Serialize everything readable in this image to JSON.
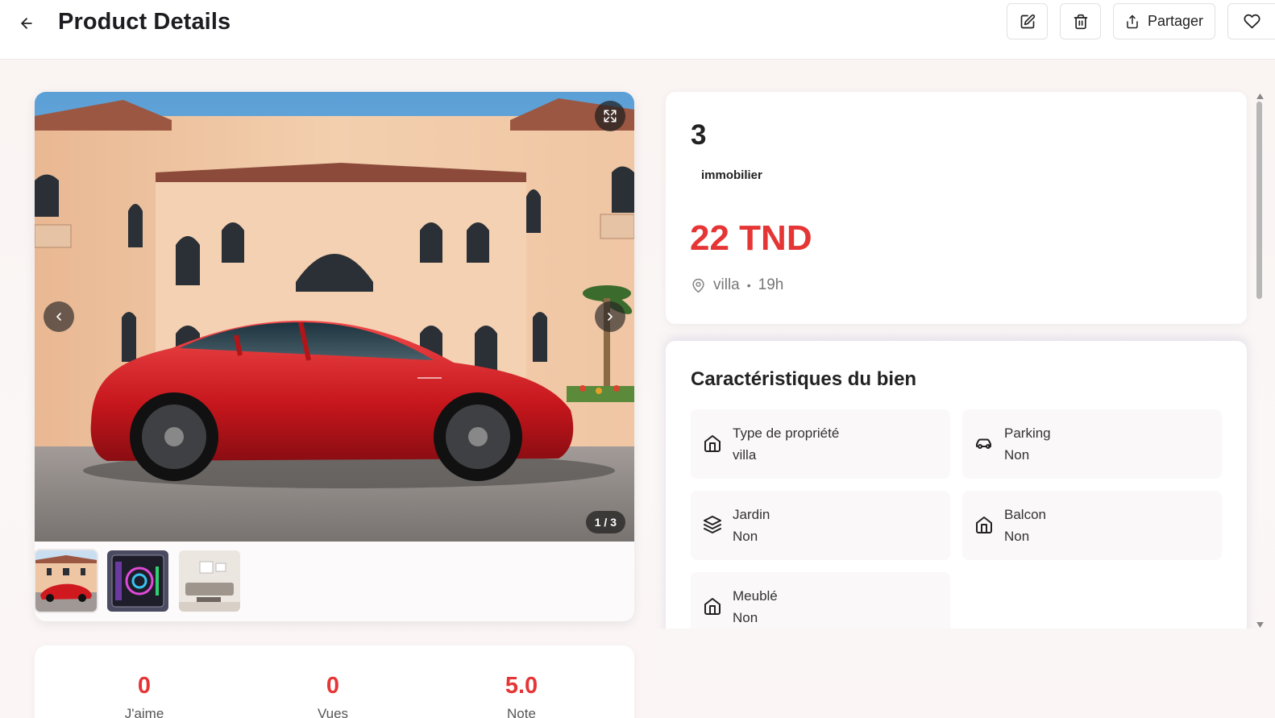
{
  "header": {
    "title": "Product Details",
    "share_label": "Partager",
    "icons": {
      "back": "arrow-left-icon",
      "edit": "pencil-square-icon",
      "delete": "trash-icon",
      "share": "upload-icon",
      "favorite": "heart-icon"
    }
  },
  "gallery": {
    "counter": "1 / 3",
    "thumbnails": [
      "red-car-villa-thumb",
      "pc-case-rgb-thumb",
      "living-room-thumb"
    ],
    "icons": {
      "fullscreen": "expand-icon",
      "prev": "chevron-left-icon",
      "next": "chevron-right-icon"
    }
  },
  "stats": [
    {
      "value": "0",
      "label": "J'aime"
    },
    {
      "value": "0",
      "label": "Vues"
    },
    {
      "value": "5.0",
      "label": "Note"
    }
  ],
  "product": {
    "name": "3",
    "category": "immobilier",
    "price": "22 TND",
    "location": "villa",
    "separator": "•",
    "age": "19h",
    "location_icon": "map-pin-icon"
  },
  "features": {
    "title": "Caractéristiques du bien",
    "items": [
      {
        "label": "Type de propriété",
        "value": "villa",
        "icon": "home-icon"
      },
      {
        "label": "Parking",
        "value": "Non",
        "icon": "car-icon"
      },
      {
        "label": "Jardin",
        "value": "Non",
        "icon": "layers-icon"
      },
      {
        "label": "Balcon",
        "value": "Non",
        "icon": "home-icon"
      },
      {
        "label": "Meublé",
        "value": "Non",
        "icon": "home-icon"
      }
    ]
  },
  "colors": {
    "accent": "#e53535",
    "text": "#1f1f23",
    "background": "#faf3f2"
  }
}
